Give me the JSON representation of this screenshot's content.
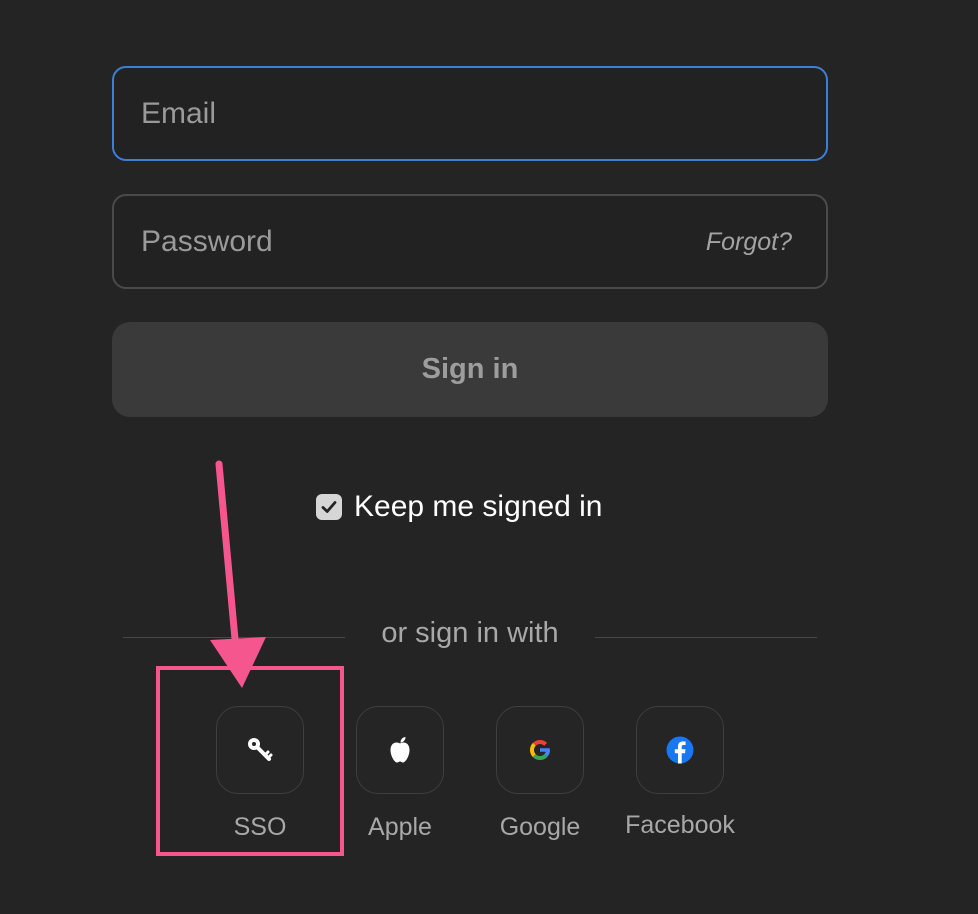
{
  "form": {
    "email_placeholder": "Email",
    "password_placeholder": "Password",
    "forgot_label": "Forgot?",
    "signin_label": "Sign in",
    "keep_signed_in_label": "Keep me signed in",
    "keep_signed_in_checked": true
  },
  "divider": {
    "label": "or sign in with"
  },
  "providers": [
    {
      "label": "SSO",
      "icon": "key-icon"
    },
    {
      "label": "Apple",
      "icon": "apple-icon"
    },
    {
      "label": "Google",
      "icon": "google-icon"
    },
    {
      "label": "Facebook",
      "icon": "facebook-icon"
    }
  ],
  "colors": {
    "background": "#242424",
    "email_focus_border": "#3f7fd2",
    "annotation": "#f5568e",
    "facebook_blue": "#1877f2"
  }
}
